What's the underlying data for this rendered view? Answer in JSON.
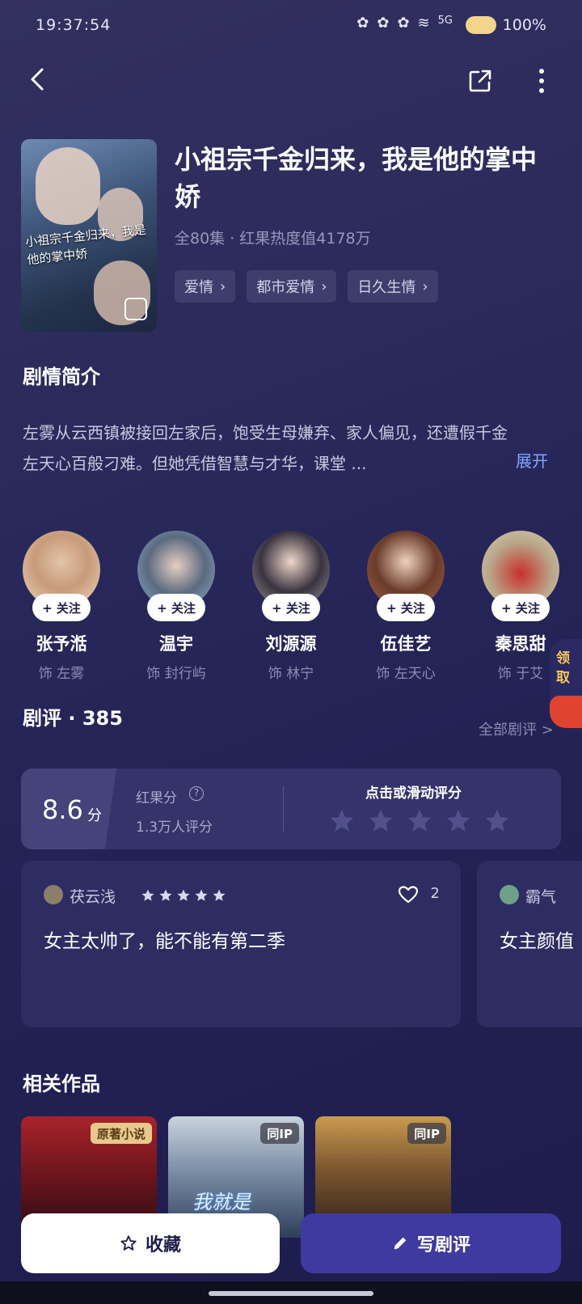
{
  "status_bar": {
    "time": "19:37:54",
    "network": "5G",
    "battery": "100%"
  },
  "drama": {
    "title": "小祖宗千金归来，我是他的掌中娇",
    "poster_title": "小祖宗千金归来，我是他的掌中娇",
    "meta": "全80集 · 红果热度值4178万",
    "tags": [
      "爱情",
      "都市爱情",
      "日久生情"
    ]
  },
  "synopsis": {
    "heading": "剧情简介",
    "text": "左雾从云西镇被接回左家后，饱受生母嫌弃、家人偏见，还遭假千金左天心百般刁难。但她凭借智慧与才华，课堂 ...",
    "expand_label": "展开"
  },
  "cast": [
    {
      "name": "张予湉",
      "role": "饰 左雾",
      "follow": "+ 关注"
    },
    {
      "name": "温宇",
      "role": "饰 封行屿",
      "follow": "+ 关注"
    },
    {
      "name": "刘源源",
      "role": "饰 林宁",
      "follow": "+ 关注"
    },
    {
      "name": "伍佳艺",
      "role": "饰 左天心",
      "follow": "+ 关注"
    },
    {
      "name": "秦思甜",
      "role": "饰 于艾",
      "follow": "+ 关注"
    }
  ],
  "side_tab": {
    "label": "领取"
  },
  "reviews": {
    "heading": "剧评 · 385",
    "all_link": "全部剧评 >",
    "score": "8.6",
    "score_unit": "分",
    "score_label": "红果分",
    "rating_count": "1.3万人评分",
    "rate_prompt": "点击或滑动评分",
    "items": [
      {
        "user": "茯云浅",
        "stars": 5,
        "likes": "2",
        "text": "女主太帅了，能不能有第二季"
      },
      {
        "user": "霸气",
        "text": "女主颜值"
      }
    ]
  },
  "related": {
    "heading": "相关作品",
    "items": [
      {
        "badge": "原著小说"
      },
      {
        "badge": "同IP",
        "overlay": "我就是"
      },
      {
        "badge": "同IP"
      }
    ]
  },
  "actions": {
    "favorite": "收藏",
    "write_review": "写剧评"
  },
  "colors": {
    "accent_blue": "#7fa6ff",
    "primary_button": "#3f3aa0",
    "badge_gold": "#f4c65c"
  }
}
